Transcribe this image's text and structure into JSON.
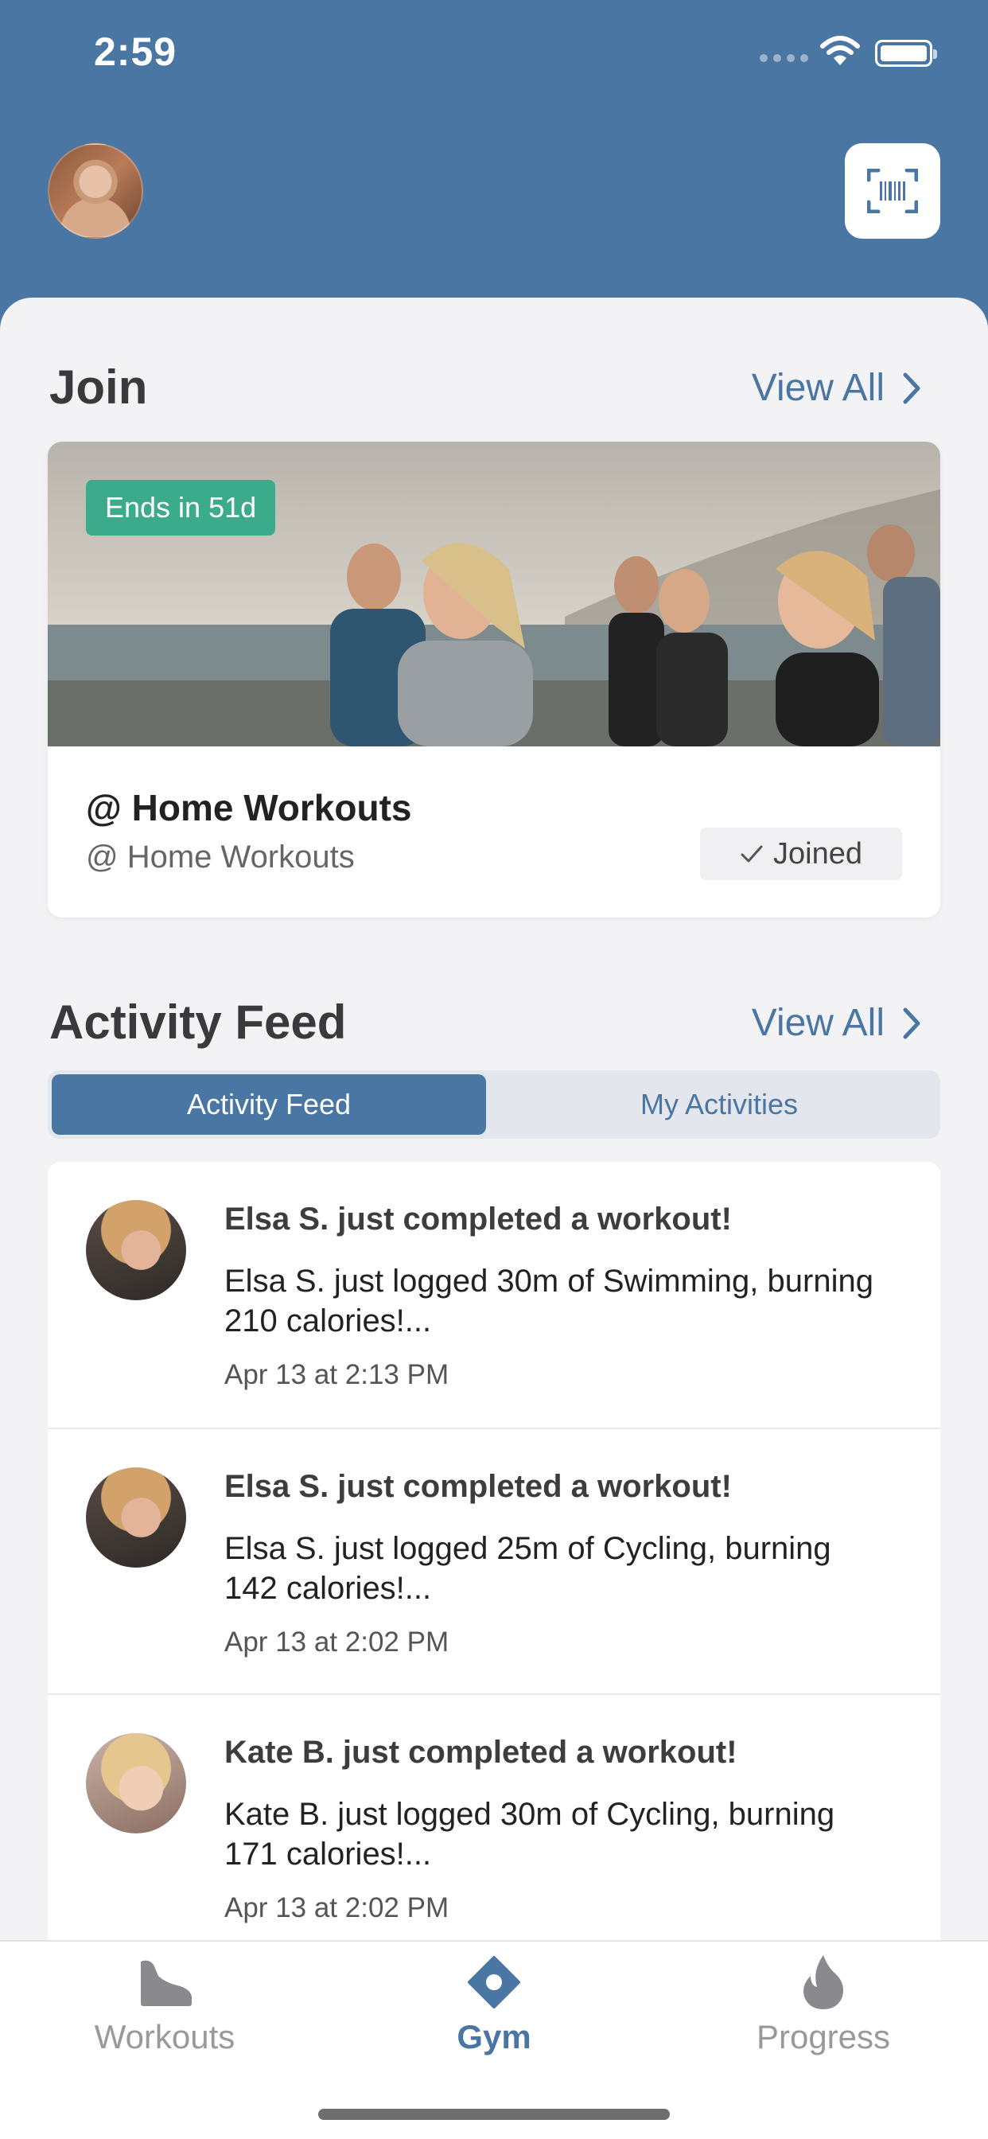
{
  "status_bar": {
    "time": "2:59"
  },
  "colors": {
    "brand": "#4a76a4",
    "badge_green": "#3bab8c"
  },
  "join_section": {
    "title": "Join",
    "view_all": "View All",
    "card": {
      "badge": "Ends in 51d",
      "title": "@ Home Workouts",
      "subtitle": "@ Home Workouts",
      "status": "Joined"
    }
  },
  "activity_section": {
    "title": "Activity Feed",
    "view_all": "View All",
    "tabs": [
      {
        "label": "Activity Feed",
        "selected": true
      },
      {
        "label": "My Activities",
        "selected": false
      }
    ],
    "items": [
      {
        "title": "Elsa S. just completed a workout!",
        "text": "Elsa S. just logged 30m of Swimming, burning 210 calories!...",
        "time": "Apr 13 at 2:13 PM"
      },
      {
        "title": "Elsa S. just completed a workout!",
        "text": "Elsa S. just logged 25m of Cycling, burning 142 calories!...",
        "time": "Apr 13 at 2:02 PM"
      },
      {
        "title": "Kate B. just completed a workout!",
        "text": "Kate B. just logged 30m of Cycling, burning 171 calories!...",
        "time": "Apr 13 at 2:02 PM"
      }
    ]
  },
  "tab_bar": {
    "items": [
      {
        "label": "Workouts",
        "icon": "shoe-icon",
        "active": false
      },
      {
        "label": "Gym",
        "icon": "gym-location-icon",
        "active": true
      },
      {
        "label": "Progress",
        "icon": "flame-icon",
        "active": false
      }
    ]
  }
}
